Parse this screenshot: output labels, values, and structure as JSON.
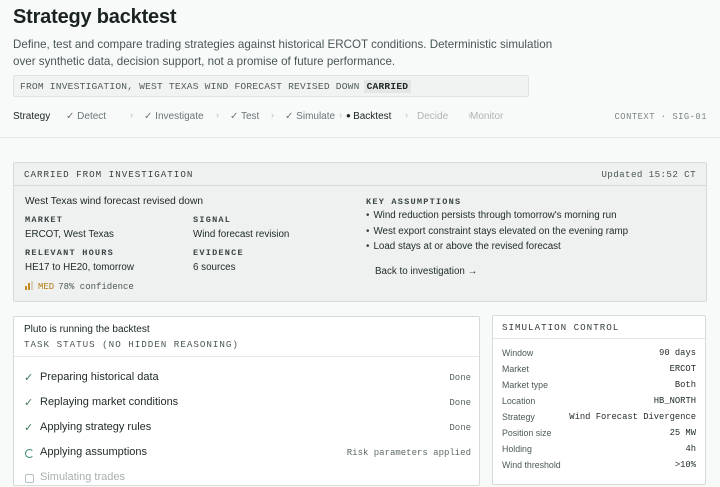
{
  "page": {
    "title": "Strategy backtest",
    "subtitle": "Define, test and compare trading strategies against historical ERCOT conditions. Deterministic simulation over synthetic data, decision support, not a promise of future performance."
  },
  "carried_bar": {
    "text": "FROM INVESTIGATION, WEST TEXAS WIND FORECAST REVISED DOWN",
    "tag": "CARRIED"
  },
  "steps": {
    "strategy": "Strategy",
    "items": [
      "Detect",
      "Investigate",
      "Test",
      "Simulate",
      "Backtest",
      "Decide",
      "Monitor"
    ],
    "context": "CONTEXT · SIG-01"
  },
  "investigation": {
    "header": "CARRIED FROM INVESTIGATION",
    "updated": "Updated 15:52 CT",
    "title": "West Texas wind forecast revised down",
    "market_label": "MARKET",
    "market": "ERCOT, West Texas",
    "signal_label": "SIGNAL",
    "signal": "Wind forecast revision",
    "hours_label": "RELEVANT HOURS",
    "hours": "HE17 to HE20, tomorrow",
    "evidence_label": "EVIDENCE",
    "evidence": "6 sources",
    "confidence_level": "MED",
    "confidence": "78% confidence",
    "assumptions_label": "KEY ASSUMPTIONS",
    "assumptions": [
      "Wind reduction persists through tomorrow's morning run",
      "West export constraint stays elevated on the evening ramp",
      "Load stays at or above the revised forecast"
    ],
    "back_link": "Back to investigation →"
  },
  "task": {
    "title": "Pluto is running the backtest",
    "subtitle": "TASK STATUS (NO HIDDEN REASONING)",
    "rows": [
      {
        "label": "Preparing historical data",
        "status": "Done",
        "state": "done"
      },
      {
        "label": "Replaying market conditions",
        "status": "Done",
        "state": "done"
      },
      {
        "label": "Applying strategy rules",
        "status": "Done",
        "state": "done"
      },
      {
        "label": "Applying assumptions",
        "status": "Risk parameters applied",
        "state": "running"
      },
      {
        "label": "Simulating trades",
        "status": "",
        "state": "pending"
      }
    ]
  },
  "simulation": {
    "header": "SIMULATION CONTROL",
    "rows": [
      {
        "k": "Window",
        "v": "90 days"
      },
      {
        "k": "Market",
        "v": "ERCOT"
      },
      {
        "k": "Market type",
        "v": "Both"
      },
      {
        "k": "Location",
        "v": "HB_NORTH"
      },
      {
        "k": "Strategy",
        "v": "Wind Forecast Divergence"
      },
      {
        "k": "Position size",
        "v": "25 MW"
      },
      {
        "k": "Holding",
        "v": "4h"
      },
      {
        "k": "Wind threshold",
        "v": ">10%"
      }
    ]
  },
  "colors": {
    "accent_green": "#2f8f6a",
    "confidence_amber": "#c88a22"
  }
}
